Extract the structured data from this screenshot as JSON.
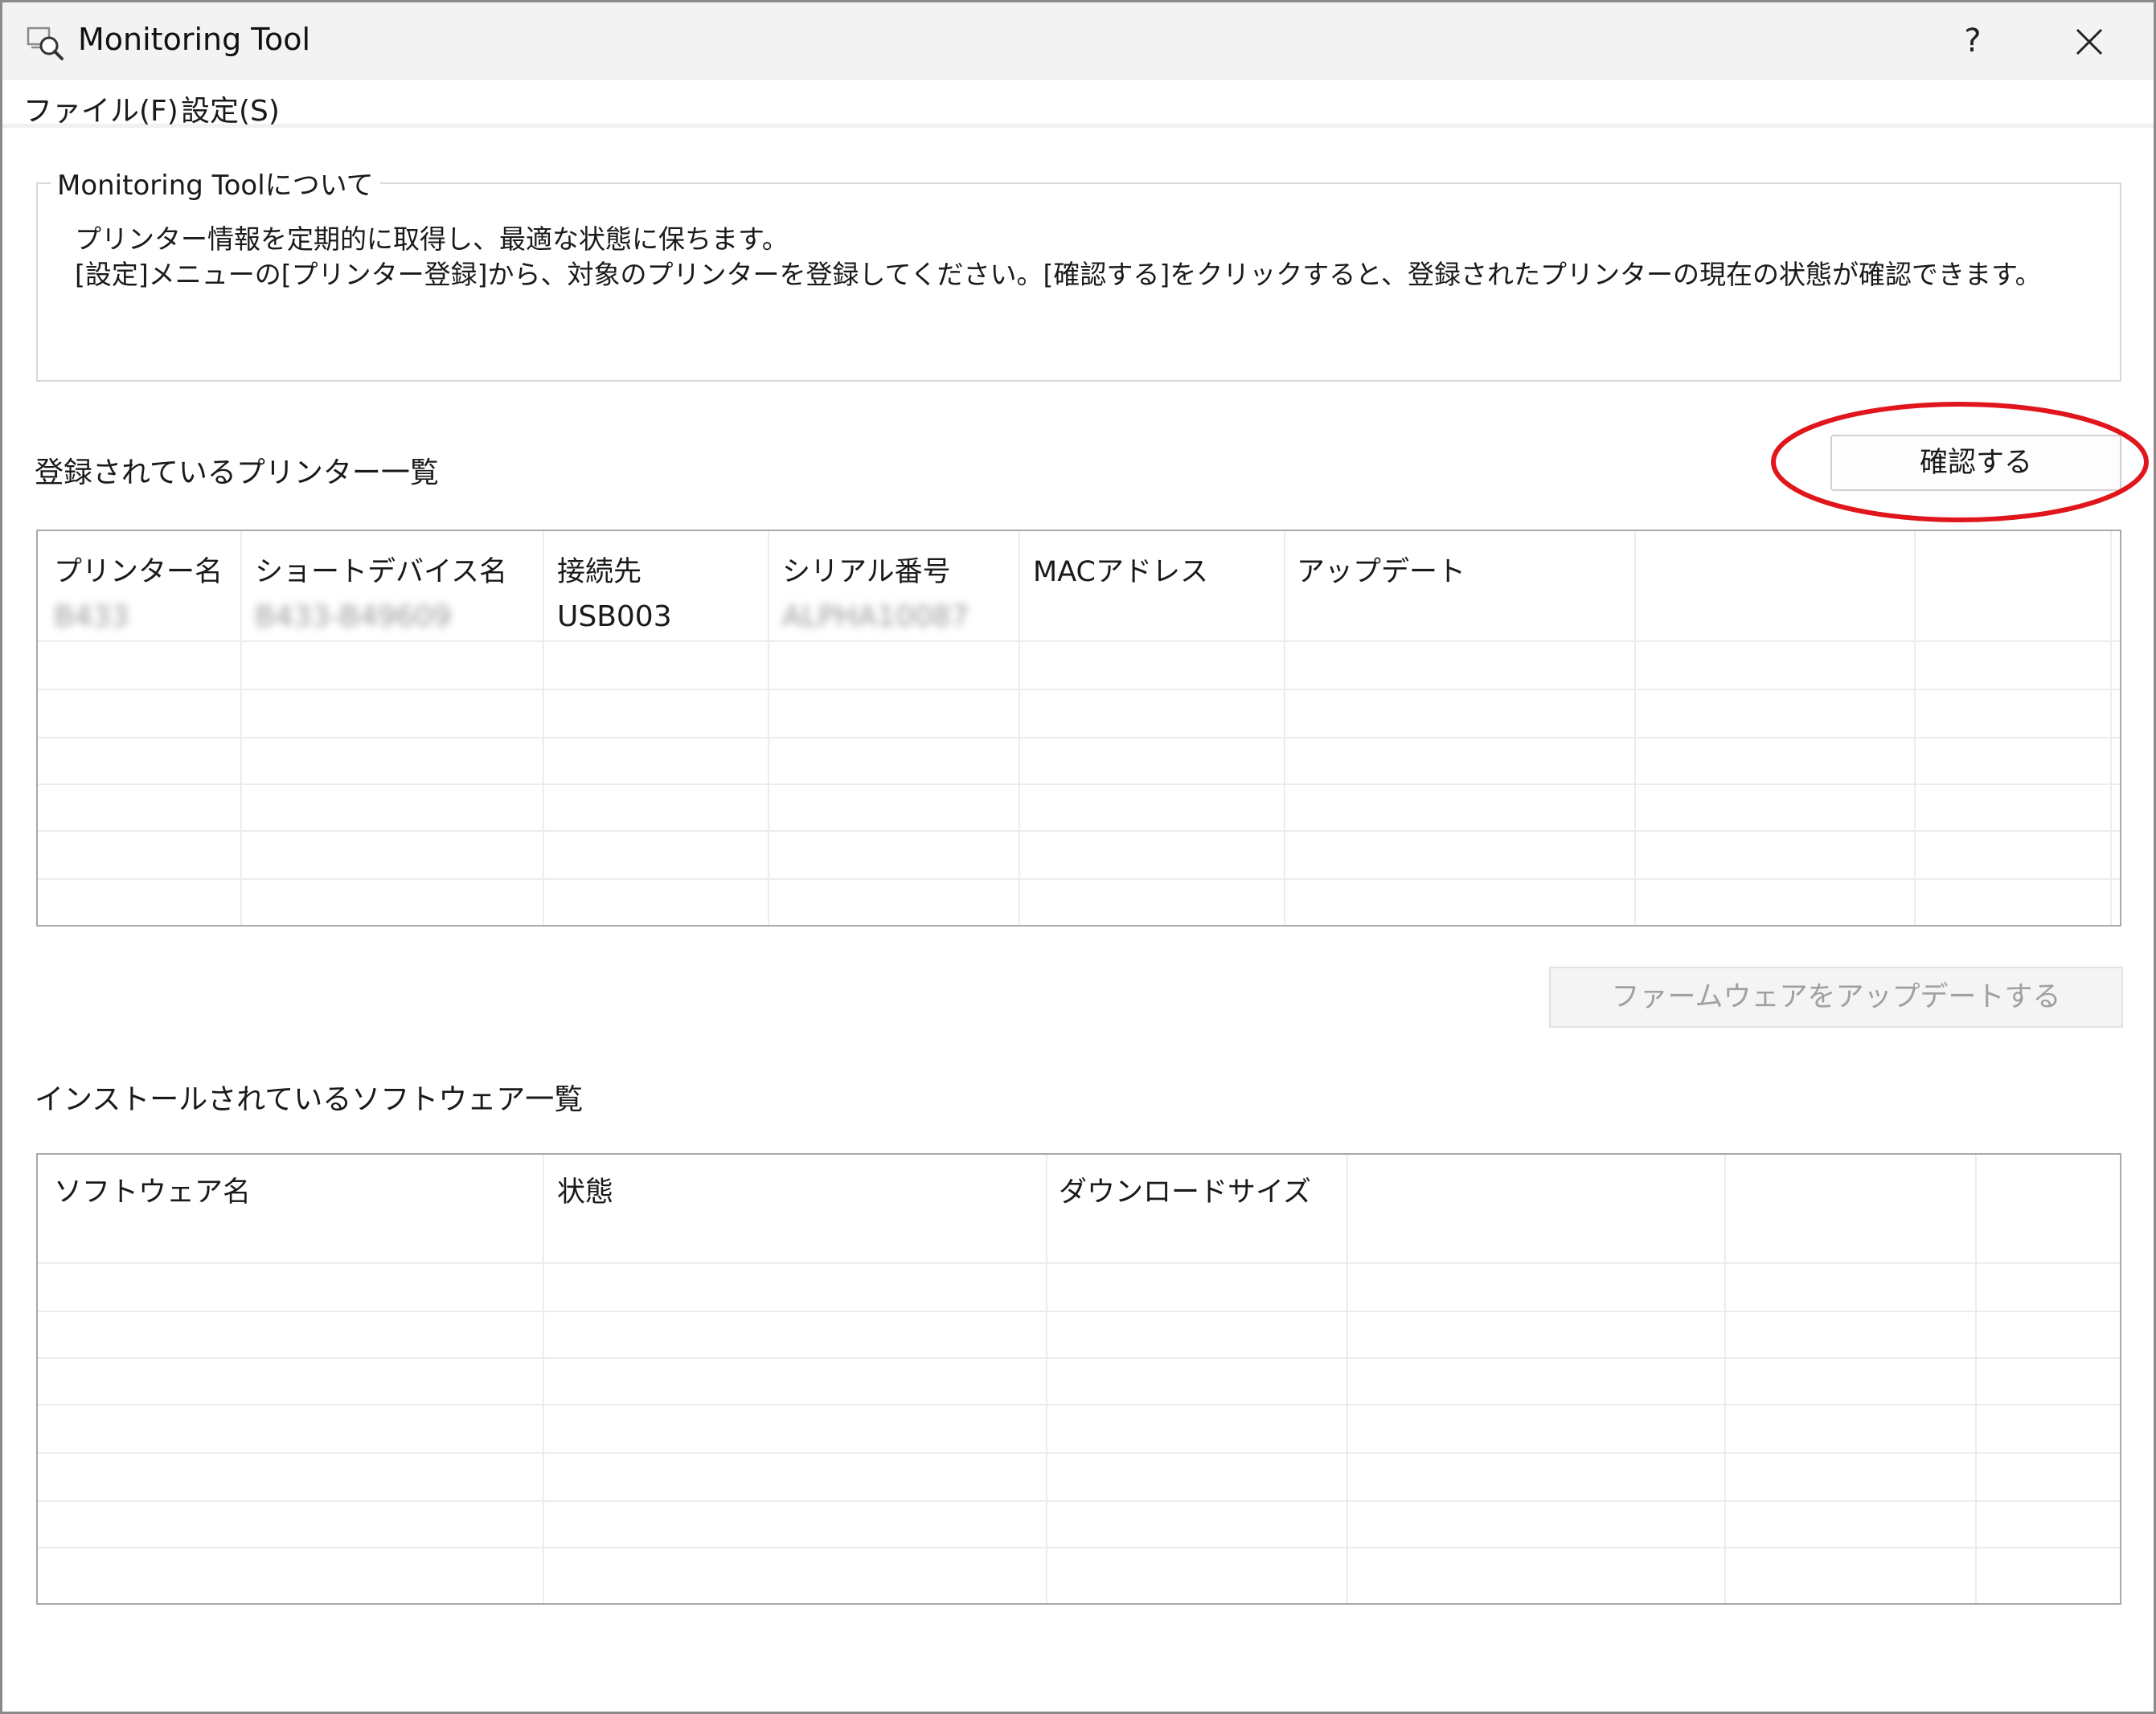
{
  "window": {
    "title": "Monitoring Tool",
    "help_label": "?",
    "icon": "magnifier-monitor-icon"
  },
  "menu": {
    "file": "ファイル(F)",
    "settings": "設定(S)"
  },
  "about": {
    "legend": "Monitoring Toolについて",
    "line1": "プリンター情報を定期的に取得し、最適な状態に保ちます。",
    "line2": "[設定]メニューの[プリンター登録]から、対象のプリンターを登録してください。[確認する]をクリックすると、登録されたプリンターの現在の状態が確認できます。"
  },
  "printers": {
    "heading": "登録されているプリンター一覧",
    "confirm_button": "確認する",
    "columns": [
      "プリンター名",
      "ショートデバイス名",
      "接続先",
      "シリアル番号",
      "MACアドレス",
      "アップデート",
      "",
      ""
    ],
    "rows": [
      {
        "name": "B433",
        "short_device": "B433-B49609",
        "connection": "USB003",
        "serial": "ALPHA10087",
        "mac": "",
        "update": ""
      }
    ],
    "firmware_button": "ファームウェアをアップデートする"
  },
  "software": {
    "heading": "インストールされているソフトウェア一覧",
    "columns": [
      "ソフトウェア名",
      "状態",
      "ダウンロードサイズ",
      "",
      "",
      ""
    ],
    "rows": []
  },
  "colors": {
    "highlight": "#e0161c",
    "disabled_text": "#a0a0a0",
    "grid_border": "#a9a9a9"
  }
}
